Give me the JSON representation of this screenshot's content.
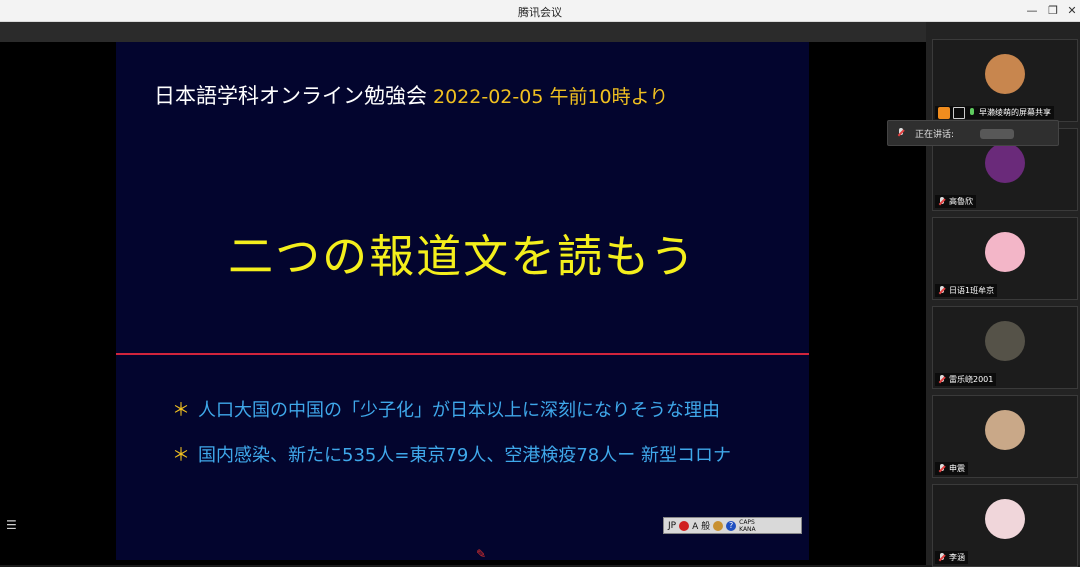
{
  "window": {
    "title": "腾讯会议"
  },
  "window_controls": {
    "minimize": "—",
    "restore": "❐",
    "close": "✕"
  },
  "slide": {
    "header": "日本語学科オンライン勉強会",
    "date": "2022-02-05 午前10時より",
    "title": "二つの報道文を読もう",
    "bullets": [
      {
        "star": "＊",
        "text": "人口大国の中国の「少子化」が日本以上に深刻になりそうな理由"
      },
      {
        "star": "＊",
        "text": "国内感染、新たに535人=東京79人、空港検疫78人ー 新型コロナ"
      }
    ]
  },
  "language_bar": {
    "lang": "JP",
    "mode": "A 般",
    "help": "?",
    "caps": "CAPS KANA"
  },
  "speaking_popup": {
    "label": "正在讲话:"
  },
  "participants": [
    {
      "name": "早濑绫萌的屏幕共享",
      "avatar_color": "#c8864e",
      "host": true
    },
    {
      "name": "高魯欣",
      "avatar_color": "#6a2a7a",
      "host": false
    },
    {
      "name": "日语1班牟京",
      "avatar_color": "#f3b6c8",
      "host": false
    },
    {
      "name": "雷乐峣2001",
      "avatar_color": "#555248",
      "host": false
    },
    {
      "name": "申震",
      "avatar_color": "#c9a888",
      "host": false
    },
    {
      "name": "李涵",
      "avatar_color": "#f0d6da",
      "host": false
    }
  ],
  "colors": {
    "slide_bg": "#03052e",
    "title_yellow": "#f4ef1c",
    "date_gold": "#f0c020",
    "bullet_blue": "#3fa8ea",
    "rule_red": "#d0243c"
  },
  "icons": {
    "list": "list-icon",
    "pen": "pen-icon",
    "mic": "mic-icon"
  }
}
